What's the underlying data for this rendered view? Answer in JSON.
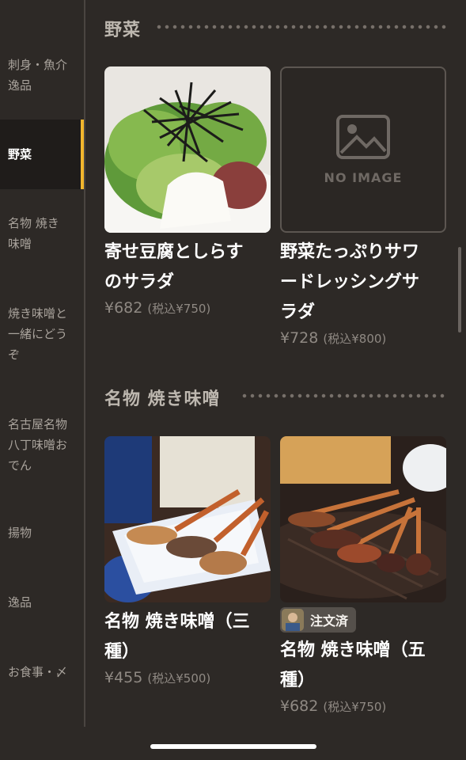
{
  "sidebar": {
    "items": [
      {
        "label_lines": [
          "刺身・魚介",
          "逸品"
        ],
        "active": false
      },
      {
        "label_lines": [
          "野菜"
        ],
        "active": true
      },
      {
        "label_lines": [
          "名物 焼き",
          "味噌"
        ],
        "active": false
      },
      {
        "label_lines": [
          "焼き味噌と",
          "一緒にどう",
          "ぞ"
        ],
        "active": false
      },
      {
        "label_lines": [
          "名古屋名物",
          "八丁味噌お",
          "でん"
        ],
        "active": false
      },
      {
        "label_lines": [
          "揚物"
        ],
        "active": false
      },
      {
        "label_lines": [
          "逸品"
        ],
        "active": false
      },
      {
        "label_lines": [
          "お食事・〆"
        ],
        "active": false
      }
    ]
  },
  "sections": [
    {
      "title": "野菜",
      "items": [
        {
          "name_lines": [
            "寄せ豆腐としらす",
            "のサラダ"
          ],
          "price": "¥682",
          "tax": "(税込¥750)",
          "image": "tofu-salad"
        },
        {
          "name_lines": [
            "野菜たっぷりサワ",
            "ードレッシングサ",
            "ラダ"
          ],
          "price": "¥728",
          "tax": "(税込¥800)",
          "image": "no-image",
          "no_image_text": "NO IMAGE"
        }
      ]
    },
    {
      "title": "名物 焼き味噌",
      "items": [
        {
          "name_lines": [
            "名物 焼き味噌（三",
            "種）"
          ],
          "price": "¥455",
          "tax": "(税込¥500)",
          "image": "miso-three"
        },
        {
          "name_lines": [
            "名物 焼き味噌（五",
            "種）"
          ],
          "price": "¥682",
          "tax": "(税込¥750)",
          "image": "miso-five",
          "badge": "注文済"
        }
      ]
    }
  ],
  "colors": {
    "accent": "#f2b62d",
    "background": "#2d2926",
    "sidebar_active": "#1f1c1a"
  }
}
